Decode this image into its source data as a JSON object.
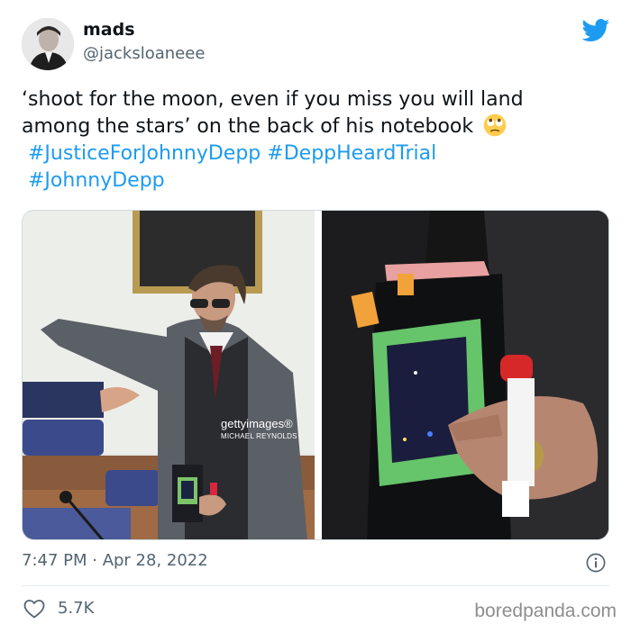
{
  "tweet": {
    "name": "mads",
    "handle": "@jacksloaneee",
    "text": {
      "line1": "‘shoot for the moon, even if you miss you will land",
      "line2": "among the stars’ on the back of his notebook",
      "hashtags": [
        "#JusticeForJohnnyDepp",
        "#DeppHeardTrial",
        "#JohnnyDepp"
      ]
    },
    "timestamp": "7:47 PM · Apr 28, 2022",
    "likes": "5.7K"
  },
  "media": {
    "getty_brand": "gettyimages®",
    "getty_credit": "MICHAEL REYNOLDS"
  },
  "icons": {
    "bird": "twitter-bird-icon",
    "emoji": "face-with-rolling-eyes-emoji",
    "info": "info-icon",
    "like": "heart-outline-icon"
  },
  "watermark": "boredpanda.com",
  "colors": {
    "link": "#1d9bf0",
    "secondary_text": "#536471",
    "twitter_blue": "#1d9bf0"
  }
}
